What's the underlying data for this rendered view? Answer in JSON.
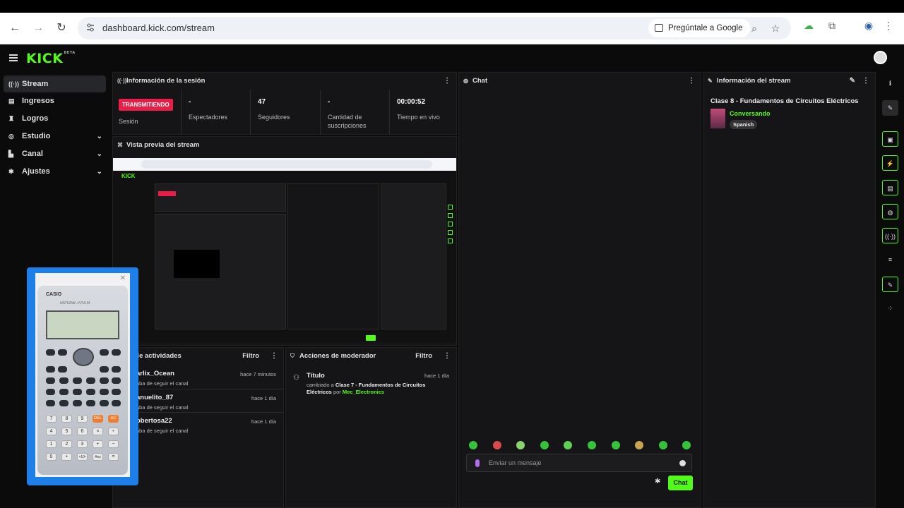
{
  "browser": {
    "url": "dashboard.kick.com/stream",
    "ask_google": "Pregúntale a Google"
  },
  "app": {
    "logo": "KICK",
    "logo_badge": "BETA"
  },
  "sidebar": {
    "items": [
      {
        "label": "Stream",
        "icon": "stream-icon",
        "active": true
      },
      {
        "label": "Ingresos",
        "icon": "wallet-icon"
      },
      {
        "label": "Logros",
        "icon": "trophy-icon"
      },
      {
        "label": "Estudio",
        "icon": "studio-icon",
        "expandable": true
      },
      {
        "label": "Canal",
        "icon": "channel-icon",
        "expandable": true
      },
      {
        "label": "Ajustes",
        "icon": "gear-icon",
        "expandable": true
      }
    ]
  },
  "session": {
    "title": "Información de la sesión",
    "live_badge": "TRANSMITIENDO",
    "session_label": "Sesión",
    "stats": [
      {
        "value": "-",
        "label": "Espectadores"
      },
      {
        "value": "47",
        "label": "Seguidores"
      },
      {
        "value": "-",
        "label": "Cantidad de suscripciones"
      },
      {
        "value": "00:00:52",
        "label": "Tiempo en vivo"
      }
    ]
  },
  "preview": {
    "title": "Vista previa del stream"
  },
  "activity": {
    "title": "l de actividades",
    "filter": "Filtro",
    "items": [
      {
        "name": "arlix_Ocean",
        "sub": "aba de seguir el canal",
        "time": "hace 7 minutos"
      },
      {
        "name": "anuelito_87",
        "sub": "aba de seguir el canal",
        "time": "hace 1 día"
      },
      {
        "name": "obertosa22",
        "sub": "aba de seguir el canal",
        "time": "hace 1 día"
      }
    ]
  },
  "mod_actions": {
    "title": "Acciones de moderador",
    "filter": "Filtro",
    "item": {
      "title": "Título",
      "time": "hace 1 día",
      "prefix": "cambiado a",
      "value": "Clase 7 - Fundamentos de Circuitos Eléctricos",
      "by": "por",
      "user": "Mec_Electronics"
    }
  },
  "chat": {
    "title": "Chat",
    "placeholder": "Enviar un mensaje",
    "send_label": "Chat",
    "accent": "#53fc18"
  },
  "stream_info": {
    "title": "Información del stream",
    "stream_title": "Clase 8 - Fundamentos de Circuitos Eléctricos",
    "category": "Conversando",
    "language": "Spanish"
  },
  "calculator": {
    "brand": "CASIO",
    "model": "NATURAL-V.P.A.M."
  }
}
